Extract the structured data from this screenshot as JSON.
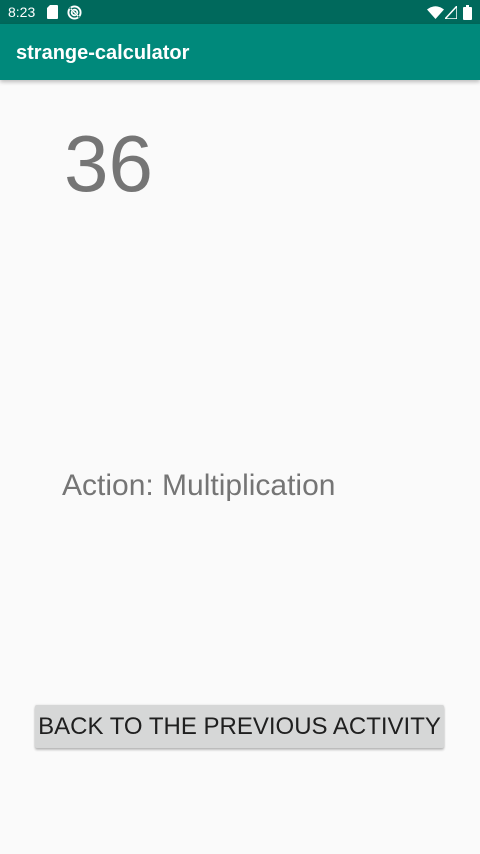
{
  "status_bar": {
    "time": "8:23",
    "icons": [
      "sd-card-icon",
      "sync-icon",
      "wifi-icon",
      "signal-icon",
      "battery-icon"
    ],
    "background_color": "#00695c"
  },
  "app_bar": {
    "title": "strange-calculator",
    "background_color": "#00897b"
  },
  "main": {
    "result": "36",
    "action_text": "Action: Multiplication",
    "back_button_label": "BACK TO THE PREVIOUS ACTIVITY"
  },
  "colors": {
    "text_secondary": "#757575",
    "button_background": "#d6d7d7",
    "page_background": "#fafafa"
  }
}
